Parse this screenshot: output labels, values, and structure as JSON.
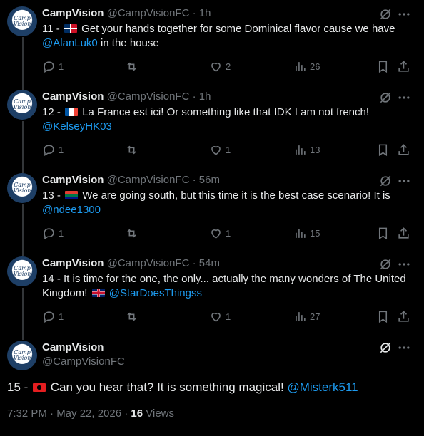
{
  "tweets": [
    {
      "name": "CampVision",
      "handle": "@CampVisionFC",
      "time": "1h",
      "prefix": "11 - ",
      "text": "Get your hands together for some Dominical flavor cause we have",
      "mention": "@AlanLuk0",
      "suffix": "in the house",
      "replies": "1",
      "retweets": "",
      "likes": "2",
      "views": "26"
    },
    {
      "name": "CampVision",
      "handle": "@CampVisionFC",
      "time": "1h",
      "prefix": "12 - ",
      "text": "La France est ici! Or something like that IDK I am not french!",
      "mention": "@KelseyHK03",
      "suffix": "",
      "replies": "1",
      "retweets": "",
      "likes": "1",
      "views": "13"
    },
    {
      "name": "CampVision",
      "handle": "@CampVisionFC",
      "time": "56m",
      "prefix": "13 - ",
      "text": "We are going south, but this time it is the best case scenario! It is",
      "mention": "@ndee1300",
      "suffix": "",
      "replies": "1",
      "retweets": "",
      "likes": "1",
      "views": "15"
    },
    {
      "name": "CampVision",
      "handle": "@CampVisionFC",
      "time": "54m",
      "prefix": "14 - ",
      "text": "It is time for the one, the only... actually the many wonders of The United Kingdom!",
      "mention": "@StarDoesThingss",
      "suffix": "",
      "replies": "1",
      "retweets": "",
      "likes": "1",
      "views": "27"
    }
  ],
  "main": {
    "name": "CampVision",
    "handle": "@CampVisionFC",
    "prefix": "15 - ",
    "text": "Can you hear that? It is something magical!",
    "mention": "@Misterk511",
    "time": "7:32 PM · May 22, 2026 · ",
    "views_count": "16",
    "views_label": " Views"
  },
  "avatar_text": "Camp Vision",
  "separator": " · ",
  "colors": {
    "accent": "#1d9bf0",
    "muted": "#71767b",
    "text": "#e7e9ea",
    "bg": "#000000"
  },
  "icons": [
    "reply-icon",
    "retweet-icon",
    "like-icon",
    "views-icon",
    "bookmark-icon",
    "share-icon",
    "grok-icon",
    "more-icon"
  ]
}
